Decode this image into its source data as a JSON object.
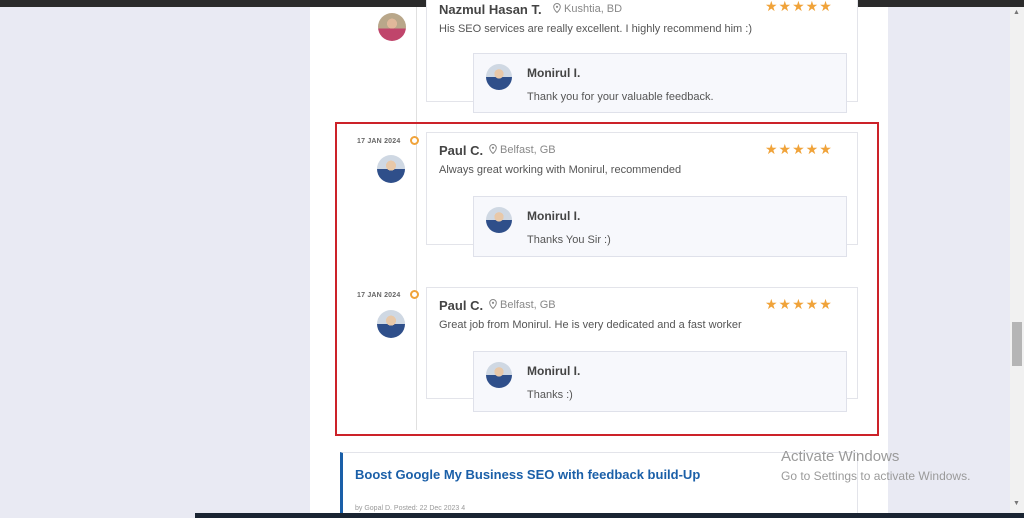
{
  "reviews": [
    {
      "name": "Nazmul Hasan T.",
      "location": "Kushtia, BD",
      "stars": "★★★★★",
      "text": "His SEO services are really excellent. I highly recommend him :)",
      "reply": {
        "name": "Monirul I.",
        "text": "Thank you for your valuable feedback."
      }
    },
    {
      "date": "17 JAN 2024",
      "name": "Paul C.",
      "location": "Belfast, GB",
      "stars": "★★★★★",
      "text": "Always great working with Monirul, recommended",
      "reply": {
        "name": "Monirul I.",
        "text": "Thanks You Sir :)"
      }
    },
    {
      "date": "17 JAN 2024",
      "name": "Paul C.",
      "location": "Belfast, GB",
      "stars": "★★★★★",
      "text": "Great job from Monirul. He is very dedicated and a fast worker",
      "reply": {
        "name": "Monirul I.",
        "text": "Thanks :)"
      }
    }
  ],
  "post": {
    "title": "Boost Google My Business SEO with feedback build-Up",
    "meta": "by Gopal D.    Posted: 22 Dec 2023    4"
  },
  "watermark": {
    "line1": "Activate Windows",
    "line2": "Go to Settings to activate Windows."
  },
  "colors": {
    "accent": "#f0a33a",
    "link": "#1a5fa8",
    "highlight": "#cc2229"
  }
}
